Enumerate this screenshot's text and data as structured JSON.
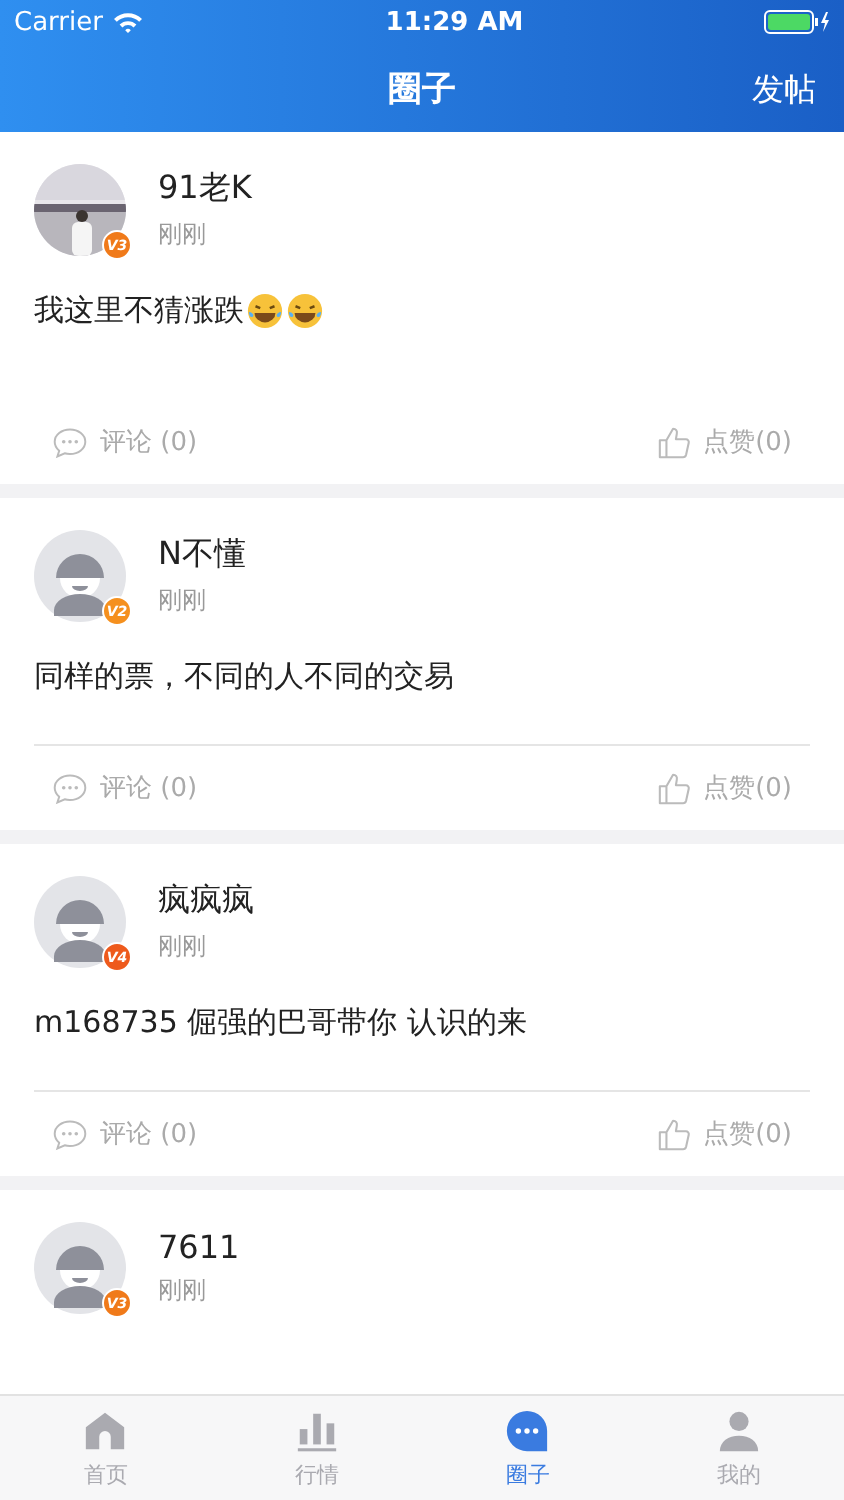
{
  "status_bar": {
    "carrier": "Carrier",
    "time": "11:29 AM"
  },
  "nav": {
    "title": "圈子",
    "action": "发帖"
  },
  "posts": [
    {
      "user": "91老K",
      "badge": {
        "text": "V3",
        "color": "#f07a1a"
      },
      "time": "刚刚",
      "content": "我这里不猜涨跌",
      "emojis": [
        {
          "kind": "laugh"
        },
        {
          "kind": "laugh"
        }
      ],
      "divider": false,
      "comment": "评论 (0)",
      "like": "点赞(0)"
    },
    {
      "user": "N不懂",
      "avatar": {
        "kind": "default"
      },
      "badge": {
        "text": "V2",
        "color": "#f5901e"
      },
      "time": "刚刚",
      "content": "同样的票，不同的人不同的交易",
      "divider": true,
      "comment": "评论 (0)",
      "like": "点赞(0)"
    },
    {
      "user": "疯疯疯",
      "avatar": {
        "kind": "default"
      },
      "badge": {
        "text": "V4",
        "color": "#ee5a1c"
      },
      "time": "刚刚",
      "content": "m168735   倔强的巴哥带你   认识的来",
      "divider": true,
      "comment": "评论 (0)",
      "like": "点赞(0)"
    },
    {
      "user": "7611",
      "avatar": {
        "kind": "default"
      },
      "badge": {
        "text": "V3",
        "color": "#f07a1a"
      },
      "time": "刚刚"
    }
  ],
  "tabs": [
    {
      "label": "首页",
      "kind": "home",
      "selected": false
    },
    {
      "label": "行情",
      "kind": "chart",
      "selected": false
    },
    {
      "label": "圈子",
      "kind": "chat",
      "selected": true
    },
    {
      "label": "我的",
      "kind": "person",
      "selected": false
    }
  ]
}
